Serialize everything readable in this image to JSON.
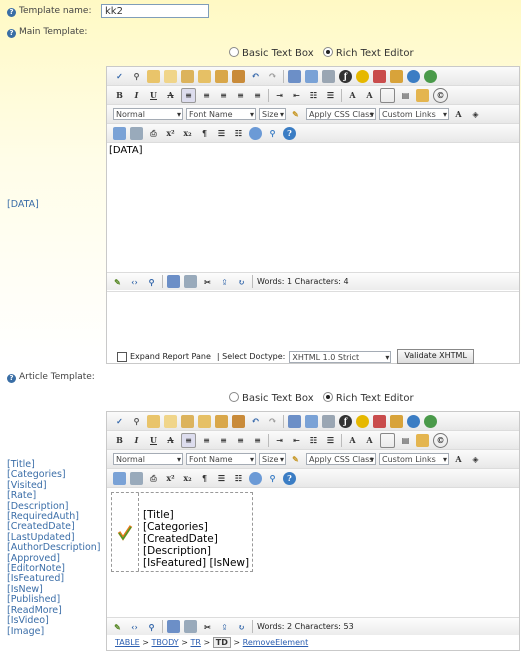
{
  "template_name": {
    "label": "Template name:",
    "value": "kk2"
  },
  "main_template": {
    "label": "Main Template:",
    "side_label": "[DATA]",
    "editor_mode": {
      "basic": "Basic Text Box",
      "rich": "Rich Text Editor",
      "selected": "rich"
    },
    "content": "[DATA]",
    "status": "Words: 1 Characters: 4",
    "expand_label": "Expand Report Pane",
    "doctype_label": "| Select Doctype:",
    "doctype_value": "XHTML 1.0 Strict",
    "validate_label": "Validate XHTML"
  },
  "article_template": {
    "label": "Article Template:",
    "fields": [
      "[Title]",
      "[Categories]",
      "[Visited]",
      "[Rate]",
      "[Description]",
      "[RequiredAuth]",
      "[CreatedDate]",
      "[LastUpdated]",
      "[AuthorDescription]",
      "[Approved]",
      "[EditorNote]",
      "[IsFeatured]",
      "[IsNew]",
      "[Published]",
      "[ReadMore]",
      "[IsVideo]",
      "[Image]"
    ],
    "editor_mode": {
      "basic": "Basic Text Box",
      "rich": "Rich Text Editor",
      "selected": "rich"
    },
    "content_lines": [
      "[Title]",
      "[Categories]",
      "[CreatedDate]",
      "[Description]",
      "[IsFeatured] [IsNew]"
    ],
    "status": "Words: 2 Characters: 53",
    "breadcrumb": {
      "table": "TABLE",
      "tbody": "TBODY",
      "tr": "TR",
      "td": "TD",
      "remove": "RemoveElement"
    }
  },
  "toolbar": {
    "style_select": "Normal",
    "font_select": "Font Name",
    "size_select": "Size",
    "css_select": "Apply CSS Class",
    "links_select": "Custom Links"
  },
  "colors": {
    "accent": "#3a6ea5",
    "background_top": "#fff9c4"
  }
}
